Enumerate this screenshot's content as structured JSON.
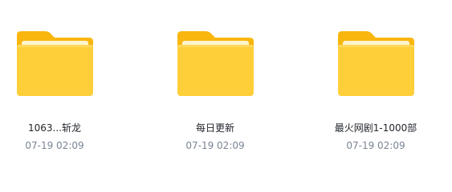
{
  "folders": [
    {
      "name": "1063...斩龙",
      "date": "07-19 02:09",
      "icon": "folder-icon"
    },
    {
      "name": "每日更新",
      "date": "07-19 02:09",
      "icon": "folder-icon"
    },
    {
      "name": "最火网剧1-1000部",
      "date": "07-19 02:09",
      "icon": "folder-icon"
    }
  ],
  "colors": {
    "folder_back": "#f9b60f",
    "folder_front": "#ffcf3a",
    "paper": "#fff4cc",
    "name_text": "#1f2329",
    "date_text": "#7a8494"
  }
}
